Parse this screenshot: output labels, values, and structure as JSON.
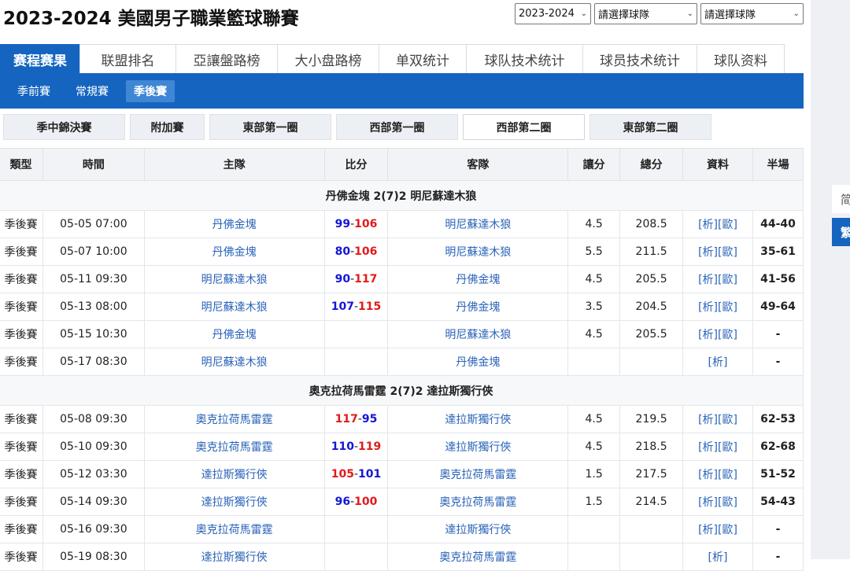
{
  "title": "2023-2024 美國男子職業籃球聯賽",
  "selects": [
    {
      "value": "2023-2024"
    },
    {
      "value": "請選擇球隊"
    },
    {
      "value": "請選擇球隊"
    }
  ],
  "main_tabs": [
    "赛程赛果",
    "联盟排名",
    "亞讓盤路榜",
    "大小盘路榜",
    "单双统计",
    "球队技术统计",
    "球员技术统计",
    "球队资料"
  ],
  "sub_tabs": [
    "季前賽",
    "常規賽",
    "季後賽"
  ],
  "round_tabs": [
    "季中錦決賽",
    "附加賽",
    "東部第一圈",
    "西部第一圈",
    "西部第二圈",
    "東部第二圈"
  ],
  "headers": [
    "類型",
    "時間",
    "主隊",
    "比分",
    "客隊",
    "讓分",
    "總分",
    "資料",
    "半場"
  ],
  "series": [
    {
      "title": "丹佛金塊 2(7)2 明尼蘇達木狼",
      "games": [
        {
          "type": "季後賽",
          "time": "05-05 07:00",
          "home": "丹佛金塊",
          "hs": "99",
          "as": "106",
          "away": "明尼蘇達木狼",
          "spread": "4.5",
          "total": "208.5",
          "data": "[析][歐]",
          "half": "44-40"
        },
        {
          "type": "季後賽",
          "time": "05-07 10:00",
          "home": "丹佛金塊",
          "hs": "80",
          "as": "106",
          "away": "明尼蘇達木狼",
          "spread": "5.5",
          "total": "211.5",
          "data": "[析][歐]",
          "half": "35-61"
        },
        {
          "type": "季後賽",
          "time": "05-11 09:30",
          "home": "明尼蘇達木狼",
          "hs": "90",
          "as": "117",
          "away": "丹佛金塊",
          "spread": "4.5",
          "total": "205.5",
          "data": "[析][歐]",
          "half": "41-56"
        },
        {
          "type": "季後賽",
          "time": "05-13 08:00",
          "home": "明尼蘇達木狼",
          "hs": "107",
          "as": "115",
          "away": "丹佛金塊",
          "spread": "3.5",
          "total": "204.5",
          "data": "[析][歐]",
          "half": "49-64"
        },
        {
          "type": "季後賽",
          "time": "05-15 10:30",
          "home": "丹佛金塊",
          "hs": "",
          "as": "",
          "away": "明尼蘇達木狼",
          "spread": "4.5",
          "total": "205.5",
          "data": "[析][歐]",
          "half": "-"
        },
        {
          "type": "季後賽",
          "time": "05-17 08:30",
          "home": "明尼蘇達木狼",
          "hs": "",
          "as": "",
          "away": "丹佛金塊",
          "spread": "",
          "total": "",
          "data": "[析]",
          "half": "-"
        }
      ]
    },
    {
      "title": "奧克拉荷馬雷霆 2(7)2 達拉斯獨行俠",
      "games": [
        {
          "type": "季後賽",
          "time": "05-08 09:30",
          "home": "奧克拉荷馬雷霆",
          "hs": "117",
          "as": "95",
          "away": "達拉斯獨行俠",
          "spread": "4.5",
          "total": "219.5",
          "data": "[析][歐]",
          "half": "62-53"
        },
        {
          "type": "季後賽",
          "time": "05-10 09:30",
          "home": "奧克拉荷馬雷霆",
          "hs": "110",
          "as": "119",
          "away": "達拉斯獨行俠",
          "spread": "4.5",
          "total": "218.5",
          "data": "[析][歐]",
          "half": "62-68"
        },
        {
          "type": "季後賽",
          "time": "05-12 03:30",
          "home": "達拉斯獨行俠",
          "hs": "105",
          "as": "101",
          "away": "奧克拉荷馬雷霆",
          "spread": "1.5",
          "total": "217.5",
          "data": "[析][歐]",
          "half": "51-52"
        },
        {
          "type": "季後賽",
          "time": "05-14 09:30",
          "home": "達拉斯獨行俠",
          "hs": "96",
          "as": "100",
          "away": "奧克拉荷馬雷霆",
          "spread": "1.5",
          "total": "214.5",
          "data": "[析][歐]",
          "half": "54-43"
        },
        {
          "type": "季後賽",
          "time": "05-16 09:30",
          "home": "奧克拉荷馬雷霆",
          "hs": "",
          "as": "",
          "away": "達拉斯獨行俠",
          "spread": "",
          "total": "",
          "data": "[析][歐]",
          "half": "-"
        },
        {
          "type": "季後賽",
          "time": "05-19 08:30",
          "home": "達拉斯獨行俠",
          "hs": "",
          "as": "",
          "away": "奧克拉荷馬雷霆",
          "spread": "",
          "total": "",
          "data": "[析]",
          "half": "-"
        }
      ]
    }
  ],
  "lang": {
    "simplified": "简",
    "traditional": "繁"
  }
}
